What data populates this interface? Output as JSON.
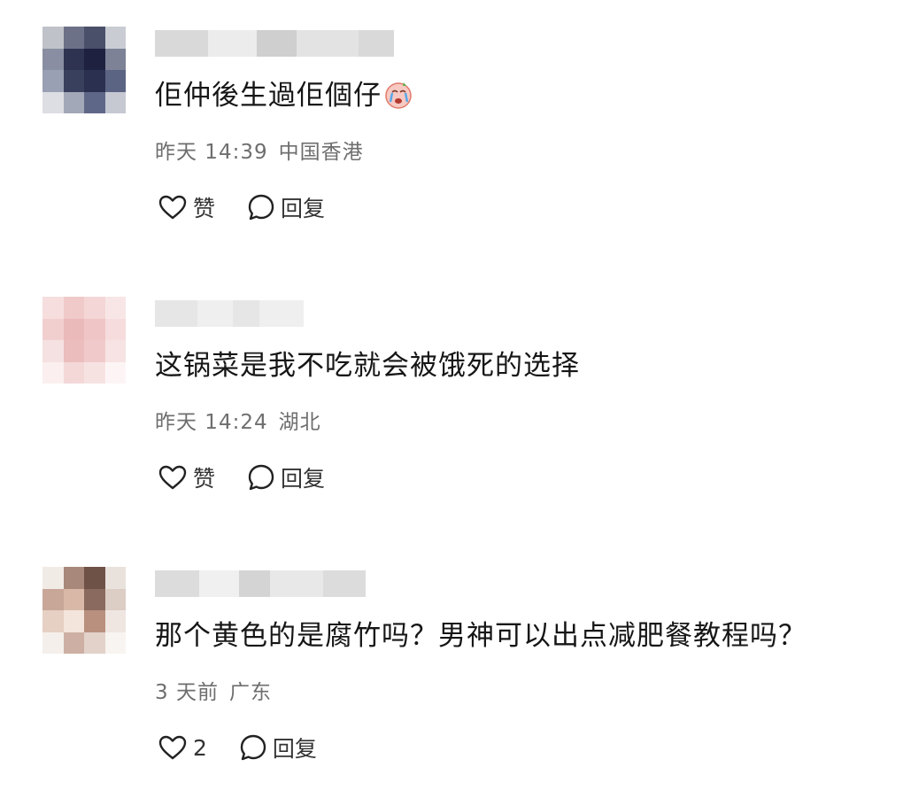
{
  "comments": [
    {
      "text": "佢仲後生過佢個仔",
      "has_emoji": true,
      "emoji_icon": "crying-face-icon",
      "time": "昨天 14:39",
      "location": "中国香港",
      "like_label": "赞",
      "reply_label": "回复",
      "avatar_colors": [
        "#bfc2c8",
        "#6d7187",
        "#4a4f6a",
        "#c9ccd3",
        "#8a8ea2",
        "#2f3352",
        "#1e2140",
        "#7d8296",
        "#9aa0b3",
        "#38405e",
        "#2b3050",
        "#5c6484",
        "#dcdee3",
        "#a3a8b8",
        "#5f6788",
        "#c6c9d2"
      ],
      "username_colors": [
        "#d9d9d9",
        "#ececec",
        "#cfcfcf",
        "#e3e3e3"
      ]
    },
    {
      "text": "这锅菜是我不吃就会被饿死的选择",
      "has_emoji": false,
      "time": "昨天 14:24",
      "location": "湖北",
      "like_label": "赞",
      "reply_label": "回复",
      "avatar_colors": [
        "#f6dede",
        "#f0c9c9",
        "#f4d6d6",
        "#f8e6e6",
        "#f2cfcf",
        "#eab9b9",
        "#efc5c5",
        "#f6dcdc",
        "#f5e1e1",
        "#ecbdbd",
        "#f0caca",
        "#f7e3e3",
        "#fbefef",
        "#f4d8d8",
        "#f7e2e2",
        "#fdf5f5"
      ],
      "username_colors": [
        "#e6e6e6",
        "#efefef"
      ]
    },
    {
      "text": "那个黄色的是腐竹吗？男神可以出点减肥餐教程吗？",
      "has_emoji": false,
      "time": "3 天前",
      "location": "广东",
      "like_count": "2",
      "reply_label": "回复",
      "avatar_colors": [
        "#f1ebe6",
        "#a7887a",
        "#6f5247",
        "#e9e1dc",
        "#c8a698",
        "#d9b8a8",
        "#8a6a5e",
        "#dccdc5",
        "#e6cfc3",
        "#f3e4dc",
        "#b98f7e",
        "#efe6e1",
        "#f4efeb",
        "#cdb0a3",
        "#e2d2ca",
        "#f8f4f1"
      ],
      "username_colors": [
        "#dcdcdc",
        "#f0f0f0",
        "#d4d4d4",
        "#e8e8e8"
      ]
    }
  ]
}
